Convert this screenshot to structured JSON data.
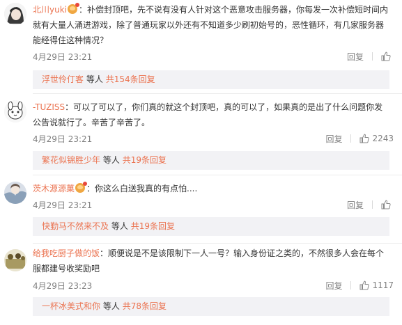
{
  "comments": [
    {
      "username": "北川yuki",
      "text": "：补偿封顶吧，先不说有没有人针对这个恶意攻击服务器，你每发一次补偿短时间内就有大量人涌进游戏，除了普通玩家以外还有不知道多少刷初始号的，恶性循环，有几家服务器能经得住这种情况？",
      "timestamp": "4月29日 23:21",
      "reply_label": "回复",
      "likes": "",
      "replies": {
        "name": "浮世伶仃客",
        "middle": "等人",
        "more": "共154条回复"
      }
    },
    {
      "username": "-TUZISS",
      "text": "：可以了可以了，你们真的就这个封顶吧，真的可以了，如果真的是出了什么问题你发公告说就行了。辛苦了辛苦了。",
      "timestamp": "4月29日 23:21",
      "reply_label": "回复",
      "likes": "2243",
      "replies": {
        "name": "繁花似锦胜少年",
        "middle": "等人",
        "more": "共19条回复"
      }
    },
    {
      "username": "茨木源源菓",
      "text": "：你这么白送我真的有点怕....",
      "timestamp": "4月29日 23:21",
      "reply_label": "回复",
      "likes": "",
      "replies": {
        "name": "快勤马不然来不及",
        "middle": "等人",
        "more": "共19条回复"
      }
    },
    {
      "username": "给我吃厨子做的饭",
      "text": "：顺便说是不是该限制下一人一号？输入身份证之类的，不然很多人会在每个服都建号收奖励吧",
      "timestamp": "4月29日 23:23",
      "reply_label": "回复",
      "likes": "1117",
      "replies": {
        "name": "一杯冰美式和你",
        "middle": "等人",
        "more": "共78条回复"
      }
    }
  ],
  "colors": {
    "accent": "#eb7350",
    "muted": "#808080",
    "reply_bg": "#f2f2f5"
  },
  "icons": {
    "like": "thumbs-up-icon",
    "badge": "vip-badge-icon"
  }
}
